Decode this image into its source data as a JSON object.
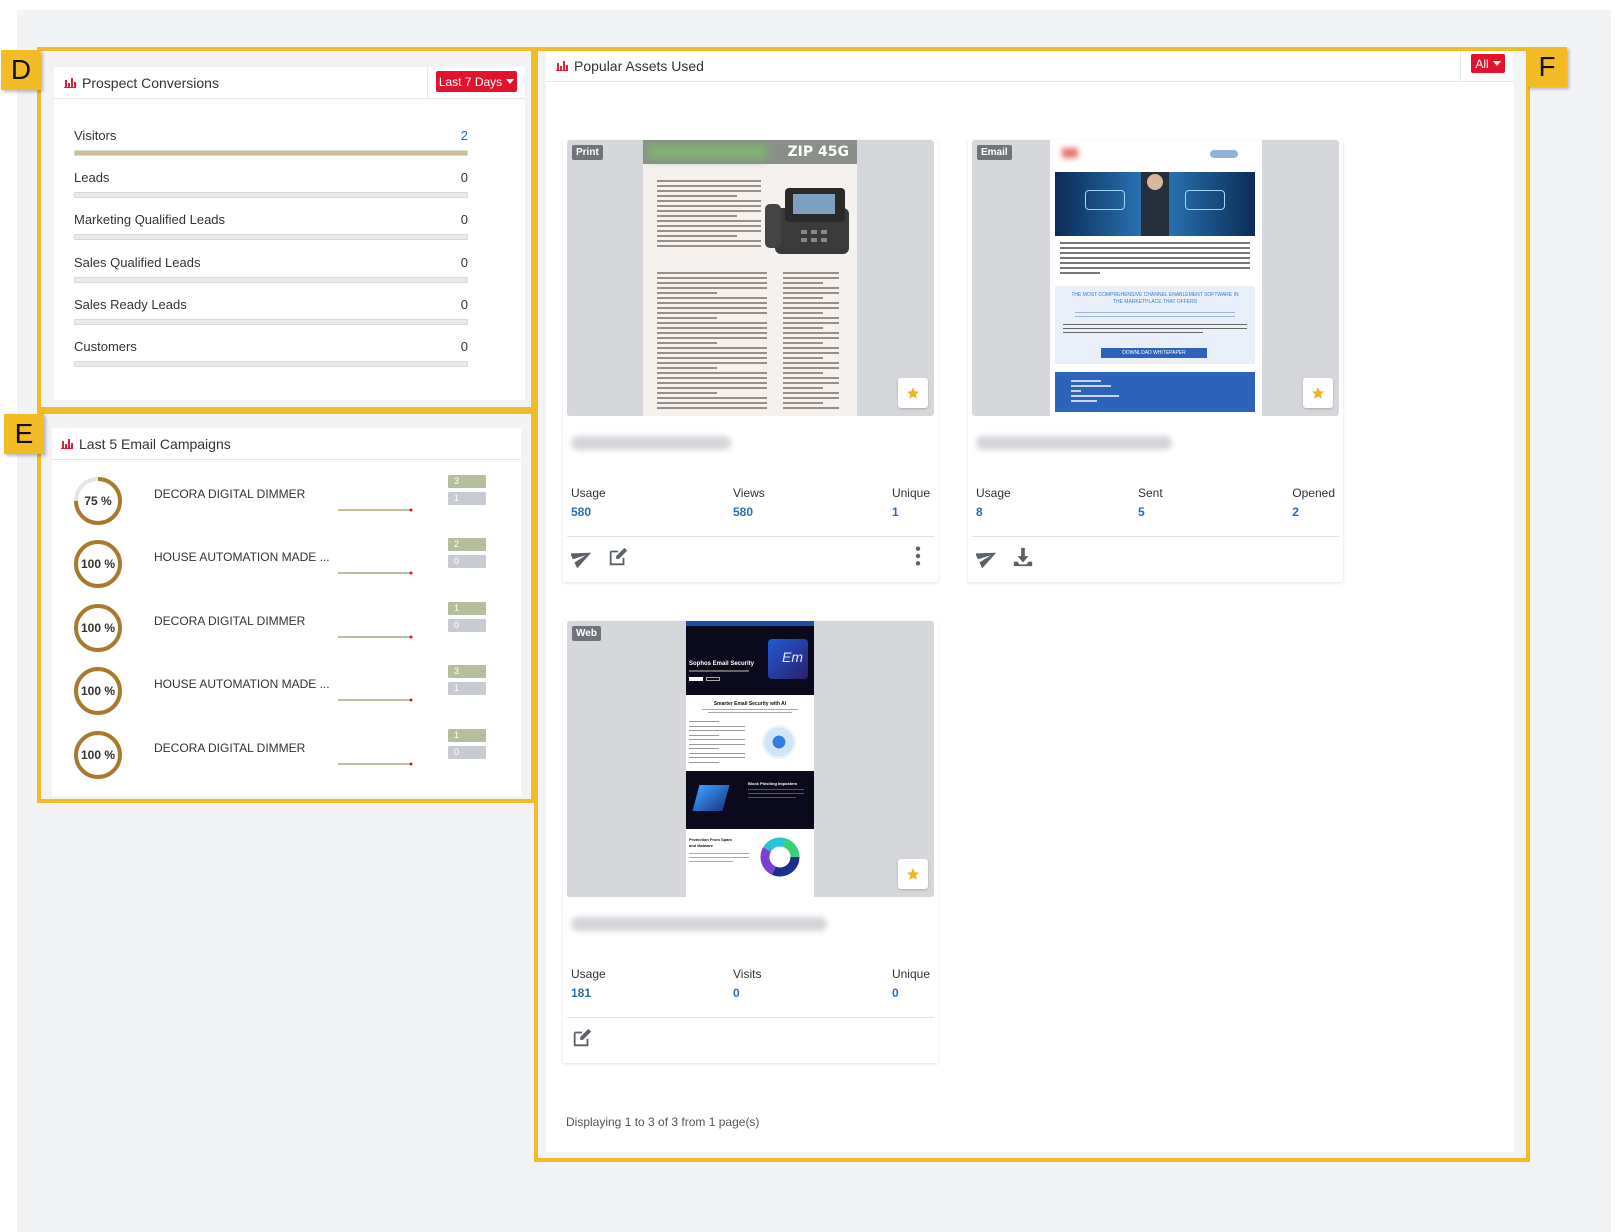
{
  "callouts": {
    "d": "D",
    "e": "E",
    "f": "F"
  },
  "prospect_conversions": {
    "title": "Prospect Conversions",
    "range_button": "Last 7 Days",
    "rows": [
      {
        "label": "Visitors",
        "value": "2",
        "fraction": 1.0
      },
      {
        "label": "Leads",
        "value": "0",
        "fraction": 0
      },
      {
        "label": "Marketing Qualified Leads",
        "value": "0",
        "fraction": 0
      },
      {
        "label": "Sales Qualified Leads",
        "value": "0",
        "fraction": 0
      },
      {
        "label": "Sales Ready Leads",
        "value": "0",
        "fraction": 0
      },
      {
        "label": "Customers",
        "value": "0",
        "fraction": 0
      }
    ]
  },
  "email_campaigns": {
    "title": "Last 5 Email Campaigns",
    "rows": [
      {
        "percent_label": "75 %",
        "percent": 75,
        "name": "DECORA DIGITAL DIMMER",
        "top_count": "3",
        "bottom_count": "1"
      },
      {
        "percent_label": "100 %",
        "percent": 100,
        "name": "HOUSE AUTOMATION MADE ...",
        "top_count": "2",
        "bottom_count": "0"
      },
      {
        "percent_label": "100 %",
        "percent": 100,
        "name": "DECORA DIGITAL DIMMER",
        "top_count": "1",
        "bottom_count": "0"
      },
      {
        "percent_label": "100 %",
        "percent": 100,
        "name": "HOUSE AUTOMATION MADE ...",
        "top_count": "3",
        "bottom_count": "1"
      },
      {
        "percent_label": "100 %",
        "percent": 100,
        "name": "DECORA DIGITAL DIMMER",
        "top_count": "1",
        "bottom_count": "0"
      }
    ]
  },
  "popular_assets": {
    "title": "Popular Assets Used",
    "filter_button": "All",
    "cards": [
      {
        "type": "Print",
        "thumb_title": "ZIP 45G",
        "stats": [
          {
            "label": "Usage",
            "value": "580"
          },
          {
            "label": "Views",
            "value": "580"
          },
          {
            "label": "Unique",
            "value": "1"
          }
        ]
      },
      {
        "type": "Email",
        "thumb_heading": "THE MOST COMPREHENSIVE CHANNEL ENABLEMENT SOFTWARE IN THE MARKETPLACE THAT OFFERS",
        "thumb_button": "DOWNLOAD WHITEPAPER",
        "stats": [
          {
            "label": "Usage",
            "value": "8"
          },
          {
            "label": "Sent",
            "value": "5"
          },
          {
            "label": "Opened",
            "value": "2"
          }
        ]
      },
      {
        "type": "Web",
        "thumb_hero": "Sophos Email Security",
        "thumb_section": "Smarter Email Security with AI",
        "thumb_section2": "Block Phishing Imposters",
        "thumb_section3": "Protection From Spam and Malware",
        "stats": [
          {
            "label": "Usage",
            "value": "181"
          },
          {
            "label": "Visits",
            "value": "0"
          },
          {
            "label": "Unique",
            "value": "0"
          }
        ]
      }
    ],
    "pagination": "Displaying 1 to 3 of 3 from 1 page(s)"
  },
  "colors": {
    "accent_red": "#e2132c",
    "callout_yellow": "#f3bb25",
    "ring_brown": "#a87a2e",
    "link_blue": "#2a6db5"
  }
}
